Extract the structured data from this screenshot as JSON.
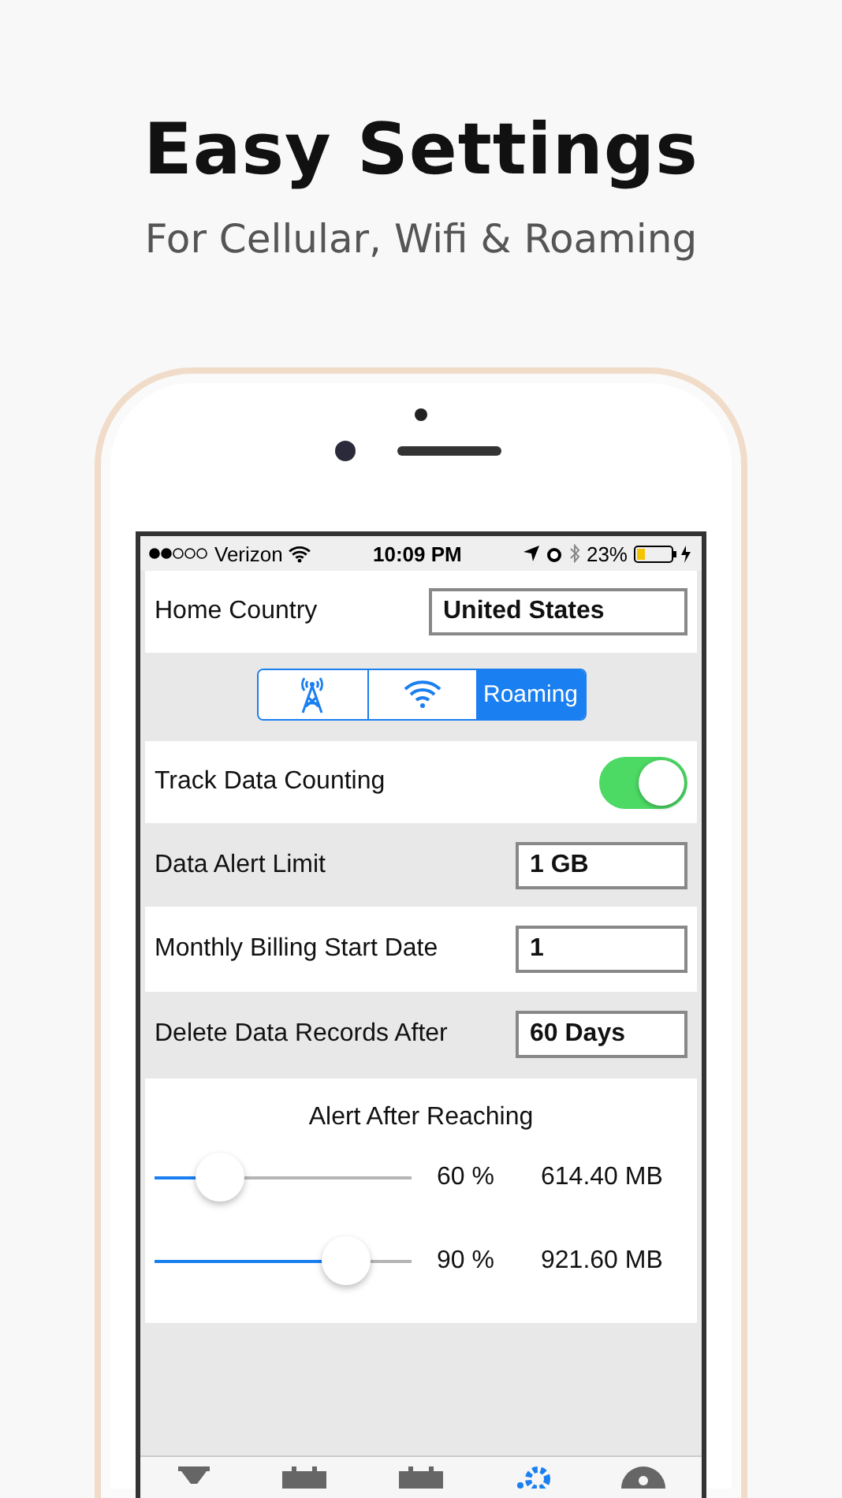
{
  "headline": "Easy Settings",
  "subheadline": "For Cellular, Wifi & Roaming",
  "status_bar": {
    "carrier": "Verizon",
    "time": "10:09 PM",
    "battery": "23%"
  },
  "home_country": {
    "label": "Home Country",
    "value": "United States"
  },
  "segments": [
    {
      "kind": "cell-tower",
      "selected": false
    },
    {
      "kind": "wifi",
      "selected": false
    },
    {
      "kind": "text",
      "label": "Roaming",
      "selected": true
    }
  ],
  "track": {
    "label": "Track Data Counting",
    "on": true
  },
  "fields": [
    {
      "label": "Data Alert Limit",
      "value": "1 GB"
    },
    {
      "label": "Monthly Billing Start Date",
      "value": "1"
    },
    {
      "label": "Delete Data Records After",
      "value": "60 Days"
    }
  ],
  "alerts": {
    "title": "Alert After Reaching",
    "sliders": [
      {
        "level": 0.25,
        "percent": "60 %",
        "amount": "614.40 MB"
      },
      {
        "level": 0.74,
        "percent": "90 %",
        "amount": "921.60 MB"
      }
    ]
  },
  "tab_bar": [
    {
      "kind": "hourglass",
      "selected": false
    },
    {
      "kind": "calendar",
      "selected": false
    },
    {
      "kind": "calendar",
      "selected": false
    },
    {
      "kind": "gear",
      "selected": true
    },
    {
      "kind": "person",
      "selected": false
    }
  ]
}
